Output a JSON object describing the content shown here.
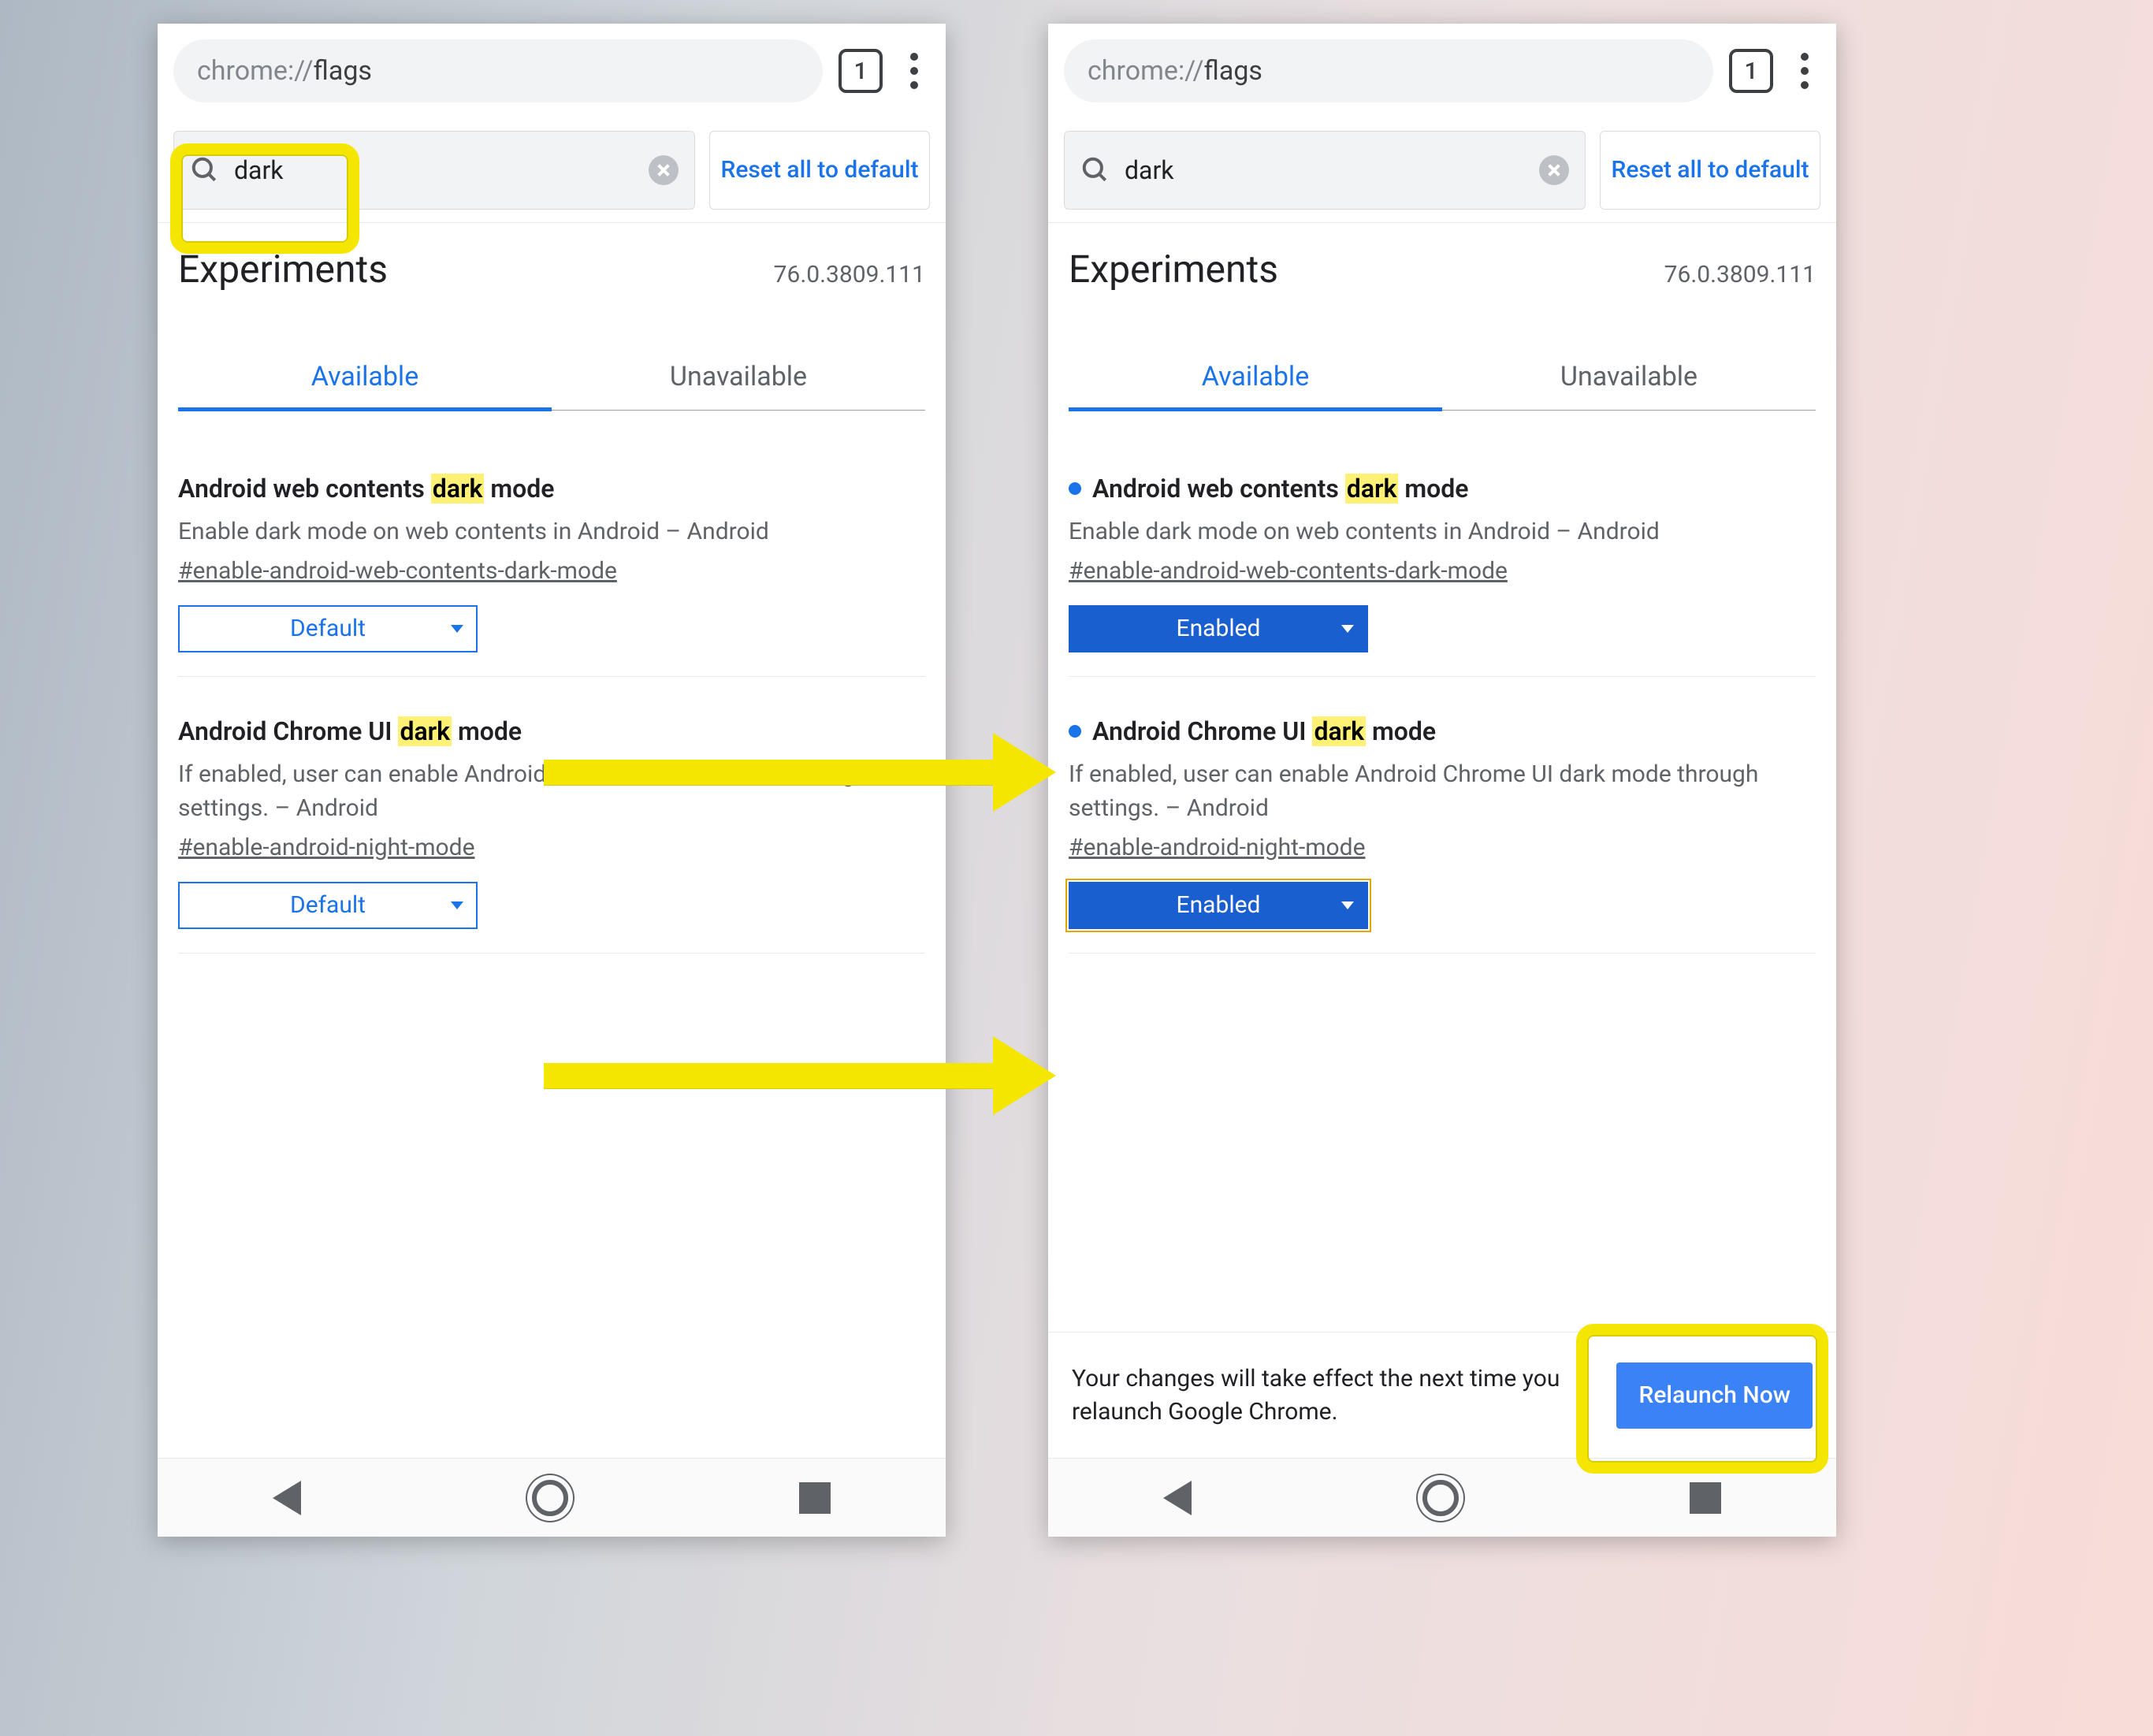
{
  "chrome": {
    "url_prefix": "chrome://",
    "url_path": "flags",
    "tab_count": "1"
  },
  "flags_page": {
    "search_value": "dark",
    "reset_label": "Reset all to default",
    "title": "Experiments",
    "version": "76.0.3809.111",
    "tabs": {
      "available": "Available",
      "unavailable": "Unavailable"
    }
  },
  "flag1": {
    "title_pre": "Android web contents ",
    "title_hl": "dark",
    "title_post": " mode",
    "desc": "Enable dark mode on web contents in Android – Android",
    "hash": "#enable-android-web-contents-dark-mode"
  },
  "flag2": {
    "title_pre": "Android Chrome UI ",
    "title_hl": "dark",
    "title_post": " mode",
    "desc": "If enabled, user can enable Android Chrome UI dark mode through settings. – Android",
    "hash": "#enable-android-night-mode"
  },
  "select_values": {
    "default": "Default",
    "enabled": "Enabled"
  },
  "relaunch": {
    "message": "Your changes will take effect the next time you relaunch Google Chrome.",
    "button": "Relaunch Now"
  }
}
